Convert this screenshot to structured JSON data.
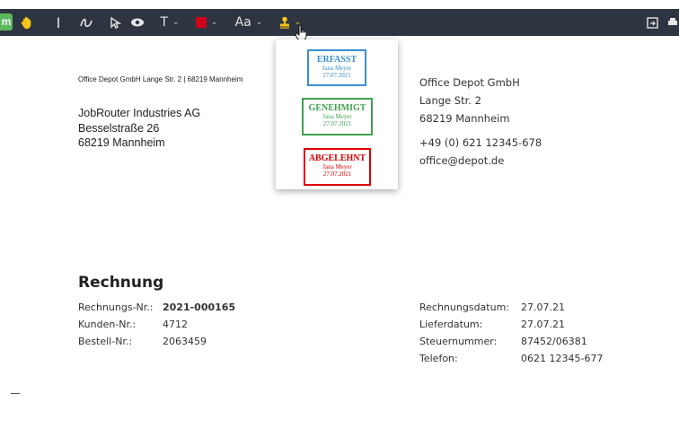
{
  "toolbar": {
    "mode_badge": "m",
    "text_tool_label": "T",
    "font_size_label": "Aa",
    "icons": [
      "hand-icon",
      "text-cursor-icon",
      "freehand-icon",
      "select-arrow-icon",
      "eye-icon",
      "text-icon",
      "color-icon",
      "font-icon",
      "stamp-icon",
      "export-icon"
    ],
    "colors": {
      "background": "#2e3440",
      "selected_color": "#d0021b",
      "stamp_icon": "#f5c518"
    }
  },
  "stamps": [
    {
      "title": "ERFASST",
      "name": "Jana Meyer",
      "date": "27.07.2021",
      "color": "#3a8fd0"
    },
    {
      "title": "GENEHMIGT",
      "name": "Jana Meyer",
      "date": "27.07.2021",
      "color": "#3fa150"
    },
    {
      "title": "ABGELEHNT",
      "name": "Jana Meyer",
      "date": "27.07.2021",
      "color": "#e00000"
    }
  ],
  "document": {
    "sender_line": "Office Depot GmbH Lange Str. 2 | 68219 Mannheim",
    "recipient": [
      "JobRouter Industries AG",
      "Besselstraße 26",
      "68219 Mannheim"
    ],
    "company": [
      "Office Depot GmbH",
      "Lange Str. 2",
      "68219 Mannheim"
    ],
    "contact": [
      "+49 (0) 621 12345-678",
      "office@depot.de"
    ],
    "title": "Rechnung",
    "left_fields": [
      {
        "label": "Rechnungs-Nr.:",
        "value": "2021-000165"
      },
      {
        "label": "Kunden-Nr.:",
        "value": "4712"
      },
      {
        "label": "Bestell-Nr.:",
        "value": "2063459"
      }
    ],
    "right_fields": [
      {
        "label": "Rechnungsdatum:",
        "value": "27.07.21"
      },
      {
        "label": "Lieferdatum:",
        "value": "27.07.21"
      },
      {
        "label": "Steuernummer:",
        "value": "87452/06381"
      },
      {
        "label": "Telefon:",
        "value": "0621 12345-677"
      }
    ]
  }
}
